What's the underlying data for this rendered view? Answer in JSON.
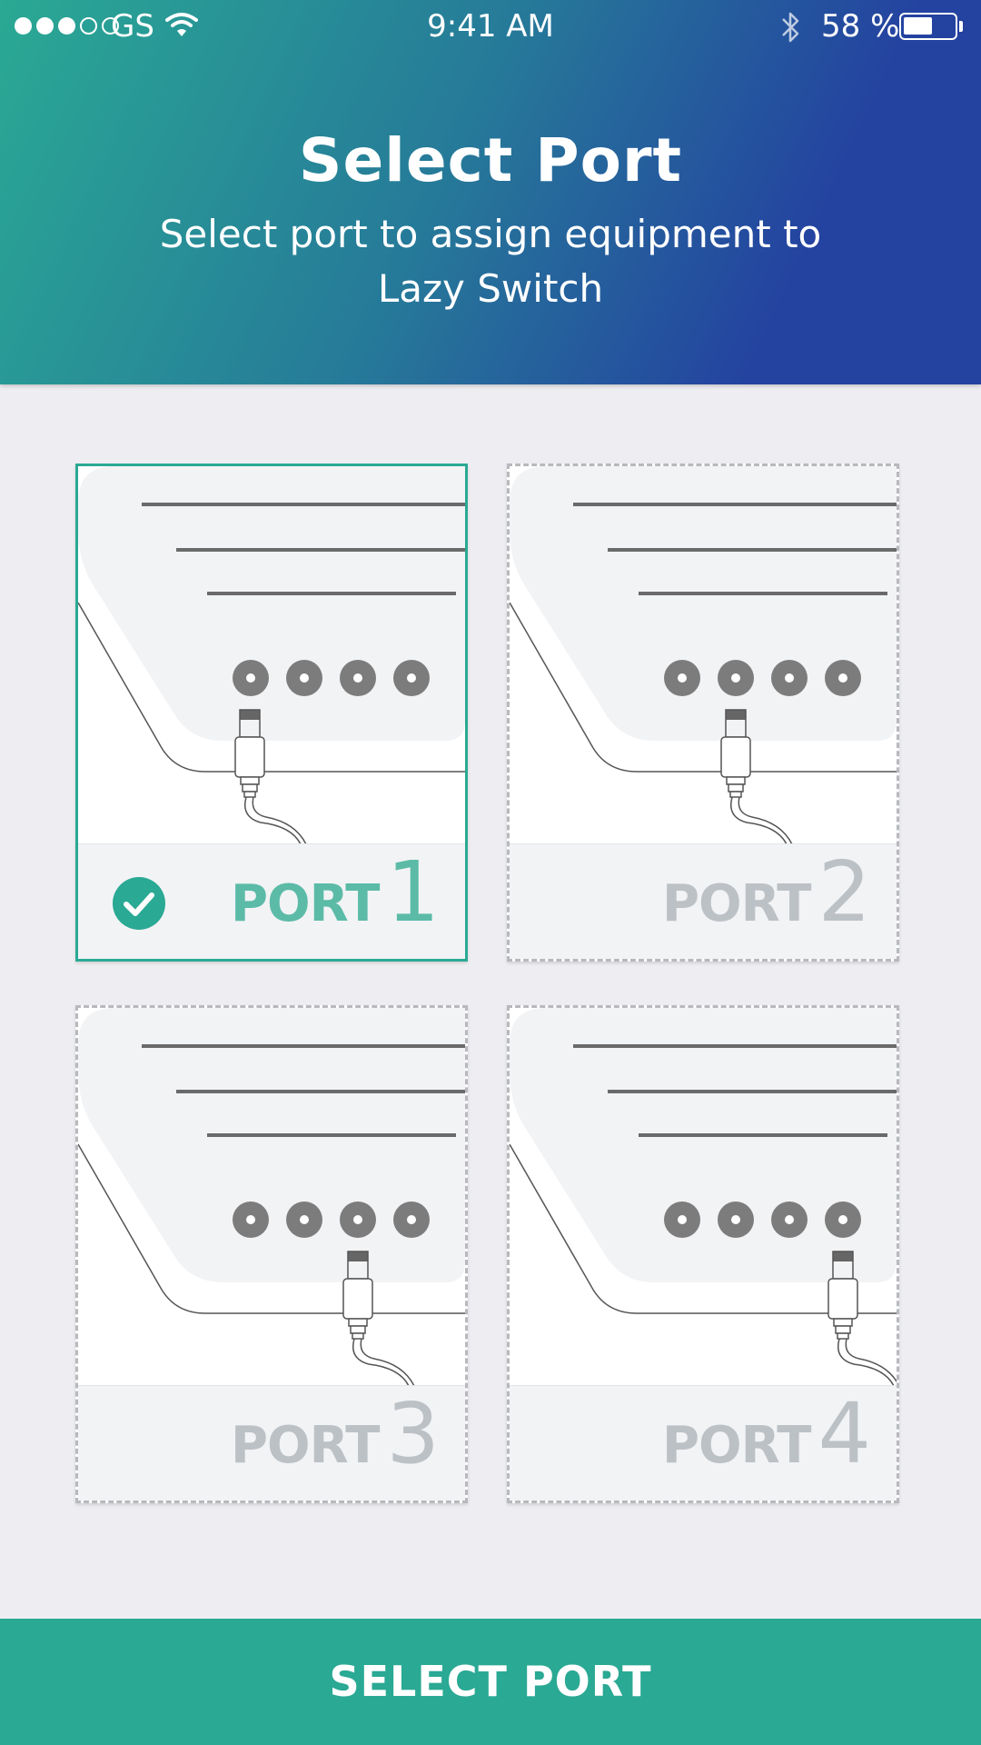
{
  "status_bar": {
    "carrier": "GS",
    "time": "9:41 AM",
    "battery_text": "58 %",
    "battery_level": 0.58,
    "signal_bars_filled": 3,
    "signal_bars_total": 5,
    "icons": [
      "wifi-icon",
      "bluetooth-icon",
      "battery-icon"
    ]
  },
  "header": {
    "title": "Select  Port",
    "subtitle": "Select port to assign equipment to Lazy Switch"
  },
  "ports": [
    {
      "word": "PORT",
      "number": "1",
      "selected": true
    },
    {
      "word": "PORT",
      "number": "2",
      "selected": false
    },
    {
      "word": "PORT",
      "number": "3",
      "selected": false
    },
    {
      "word": "PORT",
      "number": "4",
      "selected": false
    }
  ],
  "button": {
    "label": "SELECT PORT"
  },
  "colors": {
    "accent": "#2aa994",
    "header_gradient_start": "#2aa994",
    "header_gradient_end": "#2442a0",
    "background": "#eeeef2",
    "port_label_inactive": "#bcc1c6",
    "port_label_active": "#5bbba7"
  }
}
